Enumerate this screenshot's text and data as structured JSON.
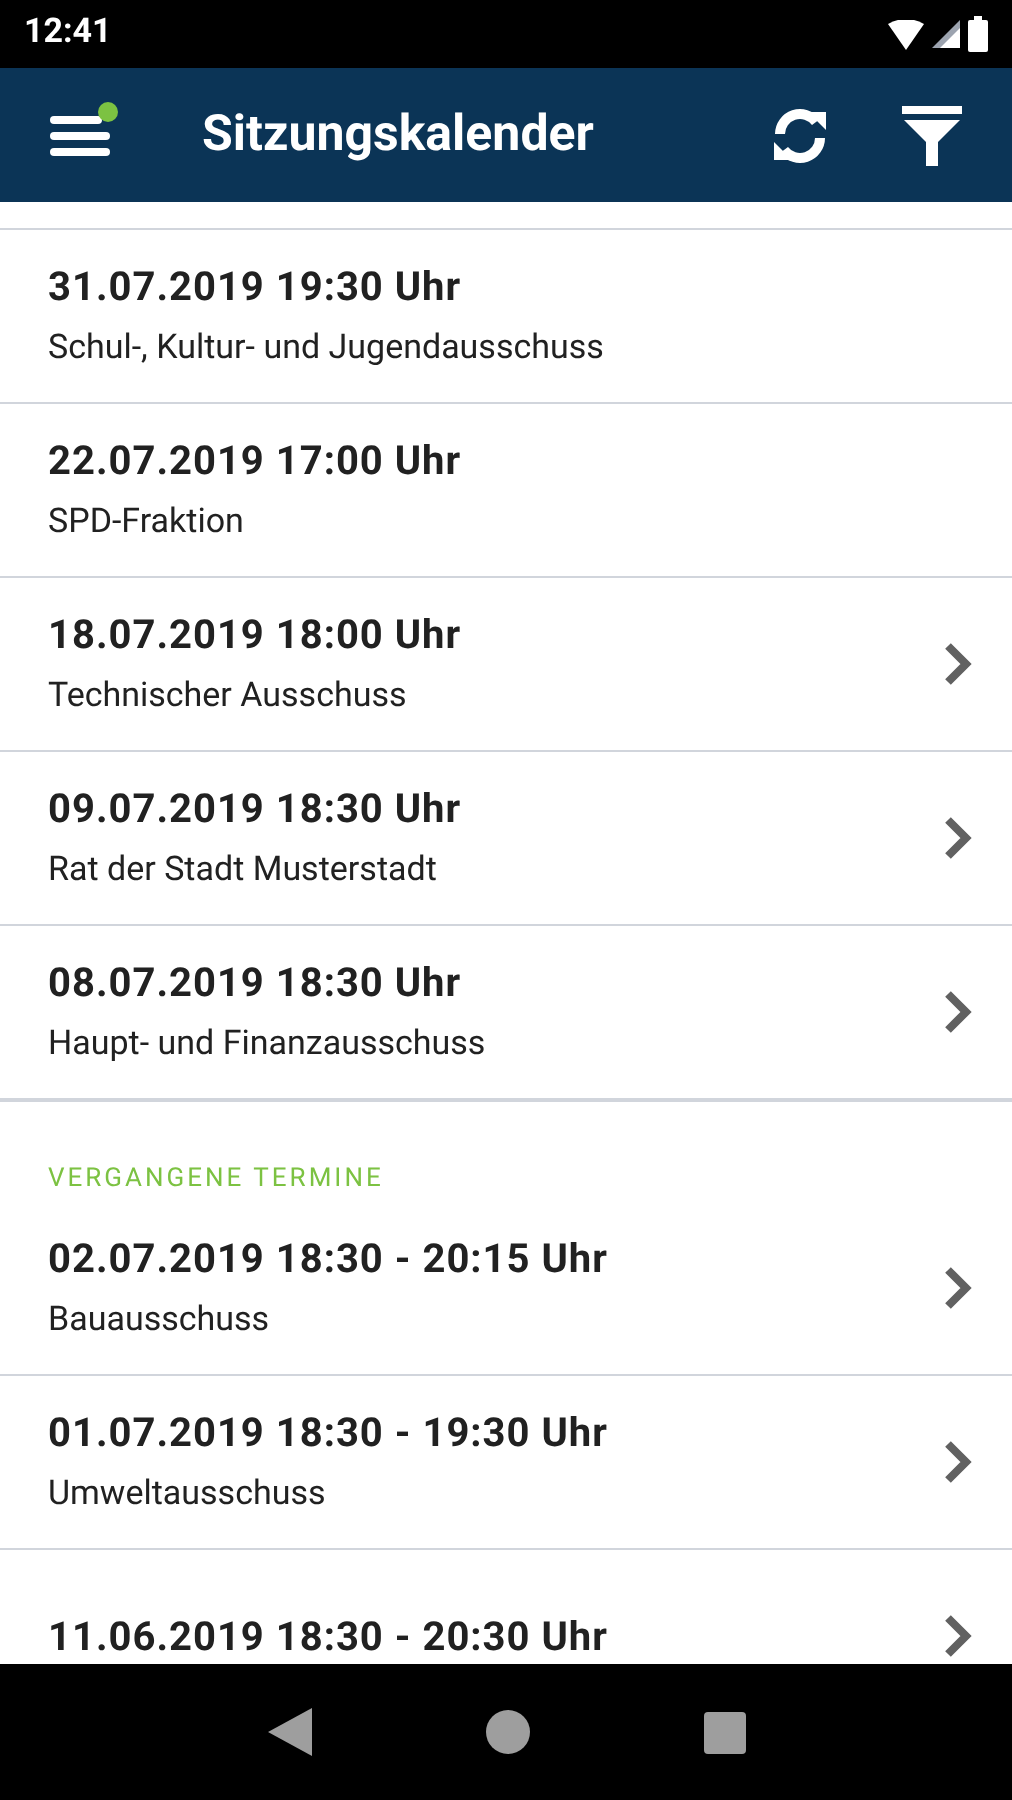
{
  "status_bar": {
    "time": "12:41"
  },
  "app_bar": {
    "title": "Sitzungskalender",
    "menu_badge": true
  },
  "sections": [
    {
      "items": [
        {
          "title": "31.07.2019 19:30 Uhr",
          "subtitle": "Schul-, Kultur- und Jugendausschuss",
          "has_detail": false
        },
        {
          "title": "22.07.2019 17:00 Uhr",
          "subtitle": "SPD-Fraktion",
          "has_detail": false
        },
        {
          "title": "18.07.2019 18:00 Uhr",
          "subtitle": "Technischer Ausschuss",
          "has_detail": true
        },
        {
          "title": "09.07.2019 18:30 Uhr",
          "subtitle": "Rat der Stadt Musterstadt",
          "has_detail": true
        },
        {
          "title": "08.07.2019 18:30 Uhr",
          "subtitle": "Haupt- und Finanzausschuss",
          "has_detail": true
        }
      ]
    },
    {
      "header": "VERGANGENE TERMINE",
      "items": [
        {
          "title": "02.07.2019 18:30 - 20:15 Uhr",
          "subtitle": "Bauausschuss",
          "has_detail": true
        },
        {
          "title": "01.07.2019 18:30 - 19:30 Uhr",
          "subtitle": "Umweltausschuss",
          "has_detail": true
        },
        {
          "title": "11.06.2019 18:30 - 20:30 Uhr",
          "has_detail": true
        }
      ]
    }
  ]
}
